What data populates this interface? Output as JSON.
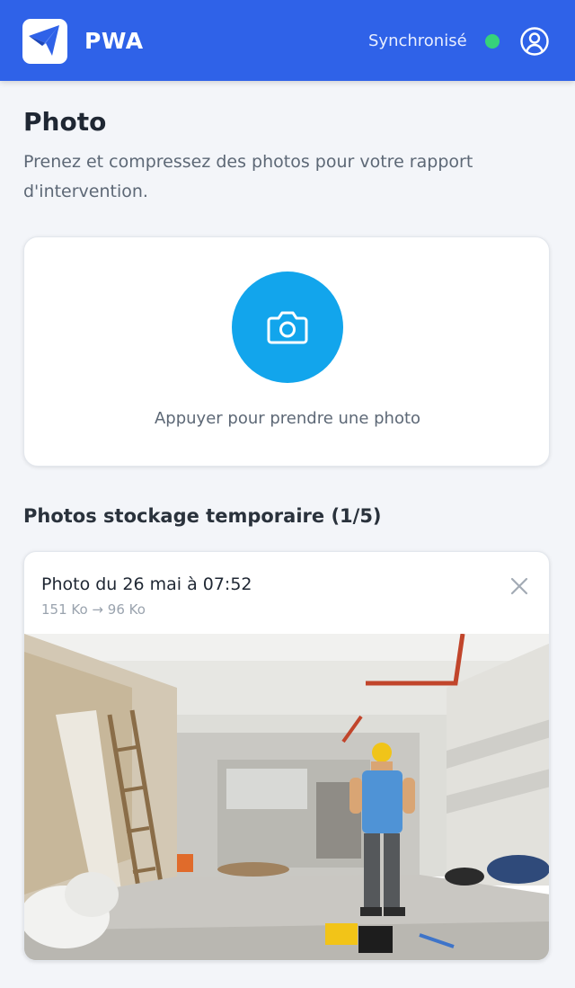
{
  "header": {
    "app_name": "PWA",
    "sync_status": "Synchronisé",
    "sync_color": "#36d27a",
    "brand_color": "#2f62e8",
    "logo_icon": "paper-plane-icon",
    "user_icon": "user-circle-icon"
  },
  "page": {
    "title": "Photo",
    "description": "Prenez et compressez des photos pour votre rapport d'intervention."
  },
  "capture": {
    "button_icon": "camera-icon",
    "button_color": "#12a5ec",
    "hint": "Appuyer pour prendre une photo"
  },
  "storage": {
    "section_title": "Photos stockage temporaire (1/5)",
    "photos": [
      {
        "title": "Photo du 26 mai à 07:52",
        "size": "151 Ko → 96 Ko",
        "close_icon": "close-icon"
      }
    ]
  }
}
